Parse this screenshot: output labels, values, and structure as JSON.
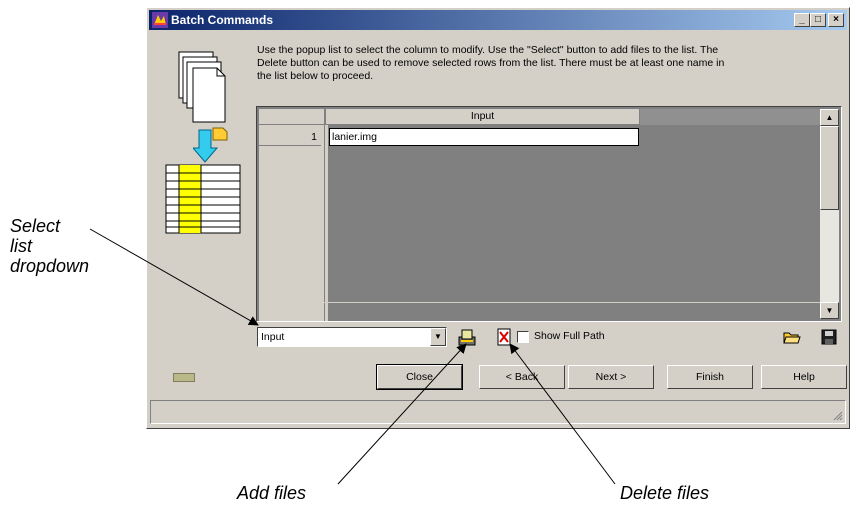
{
  "window": {
    "title": "Batch Commands",
    "caption_buttons": [
      "_",
      "□",
      "×"
    ],
    "instructions": "Use the popup list to select the column to modify. Use the \"Select\" button to add files to the list. The Delete button can be used to remove selected rows from the list. There must be at least one name in the list below to proceed."
  },
  "table": {
    "column_header": "Input",
    "rows": [
      {
        "index": "1",
        "value": "lanier.img"
      }
    ]
  },
  "toolbar": {
    "column_select_value": "Input",
    "show_full_path_label": "Show Full Path",
    "show_full_path_checked": false
  },
  "buttons": {
    "close": "Close",
    "back": "< Back",
    "next": "Next >",
    "finish": "Finish",
    "help": "Help"
  },
  "annotations": {
    "select_list_line1": "Select",
    "select_list_line2": "list",
    "select_list_line3": "dropdown",
    "add_files": "Add files",
    "delete_files": "Delete files"
  },
  "colors": {
    "titlebar_start": "#0a246a",
    "titlebar_end": "#a6caf0",
    "dialog_face": "#d4d0c8",
    "table_background": "#808080"
  },
  "icons": [
    "app-icon",
    "document-stack-icon",
    "import-arrow-icon",
    "table-grid-icon",
    "add-files-icon",
    "delete-files-icon",
    "open-folder-icon",
    "save-disk-icon",
    "resize-grip-icon"
  ]
}
